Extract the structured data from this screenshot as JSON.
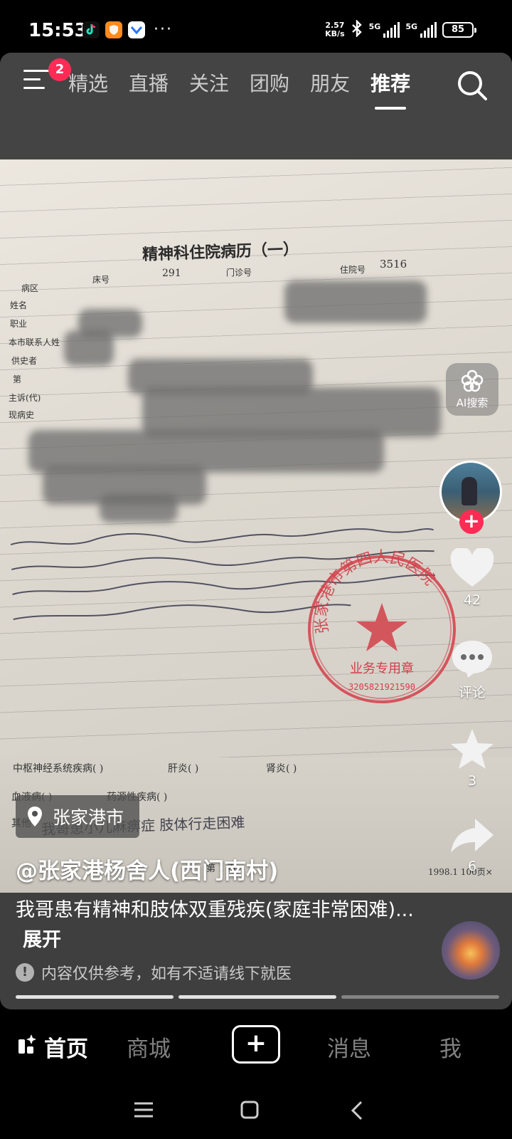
{
  "status_bar": {
    "time": "15:53",
    "speed_value": "2.57",
    "speed_unit": "KB/s",
    "network_1": "5G",
    "network_2": "5G",
    "battery": "85",
    "overflow": "···"
  },
  "top_nav": {
    "menu_badge": "2",
    "tabs": [
      {
        "label": "精选",
        "active": false
      },
      {
        "label": "直播",
        "active": false
      },
      {
        "label": "关注",
        "active": false
      },
      {
        "label": "团购",
        "active": false
      },
      {
        "label": "朋友",
        "active": false
      },
      {
        "label": "推荐",
        "active": true
      }
    ]
  },
  "document": {
    "title": "精神科住院病历（一）",
    "bed_label": "床号",
    "bed_number": "291",
    "clinic_label": "门诊号",
    "admission_label": "住院号",
    "admission_number": "3516",
    "fields": [
      "病区",
      "姓名",
      "职业",
      "本市联系人姓",
      "供史者",
      "第",
      "主诉(代)",
      "现病史"
    ],
    "lower_fields": [
      "中枢神经系统疾病(    )",
      "肝炎(    )",
      "肾炎(    )",
      "血液病(    )",
      "药源性疾病(    )",
      "其他"
    ],
    "handwritten_other": "我哥患小儿麻痹症 肢体行走困难",
    "stamp_text": "张家港市第四人民医院",
    "stamp_sub": "业务专用章",
    "stamp_number": "3205821921590",
    "page_label": "第 1 页",
    "page_code": "1998.1  100页×"
  },
  "right_rail": {
    "ai_label": "AI搜索",
    "likes": "42",
    "comments": "评论",
    "favorites": "3",
    "shares": "6"
  },
  "caption": {
    "location": "张家港市",
    "author": "@张家港杨舍人(西门南村)",
    "description": "我哥患有精神和肢体双重残疾(家庭非常困难)...",
    "more": "展开",
    "notice": "内容仅供参考，如有不适请线下就医"
  },
  "bottom_nav": {
    "home": "首页",
    "mall": "商城",
    "messages": "消息",
    "me": "我"
  },
  "colors": {
    "accent": "#fe2c55",
    "stamp": "#d2404a"
  }
}
